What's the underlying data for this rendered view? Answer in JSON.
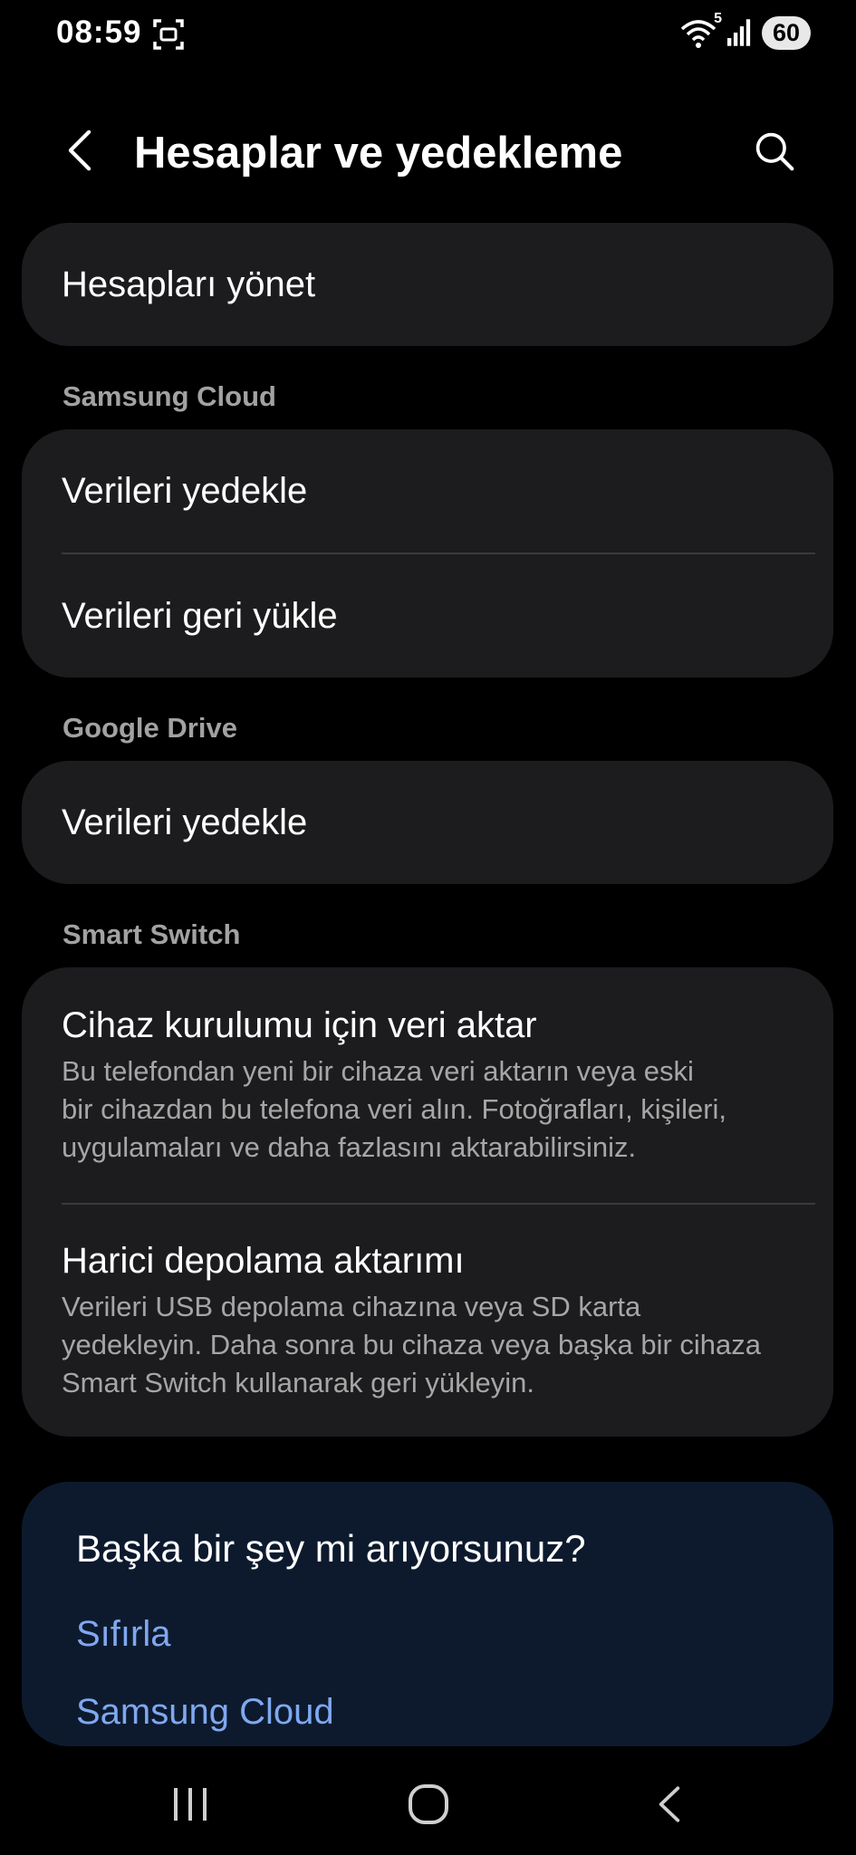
{
  "status_bar": {
    "time": "08:59",
    "wifi_badge": "5",
    "battery_level": "60",
    "icons": [
      "screen-record-icon",
      "wifi-icon",
      "signal-icon",
      "battery-icon"
    ]
  },
  "header": {
    "title": "Hesaplar ve yedekleme",
    "back_icon": "back-arrow-icon",
    "search_icon": "search-icon"
  },
  "manage_accounts": {
    "label": "Hesapları yönet"
  },
  "samsung_cloud": {
    "header": "Samsung Cloud",
    "items": [
      {
        "label": "Verileri yedekle"
      },
      {
        "label": "Verileri geri yükle"
      }
    ]
  },
  "google_drive": {
    "header": "Google Drive",
    "items": [
      {
        "label": "Verileri yedekle"
      }
    ]
  },
  "smart_switch": {
    "header": "Smart Switch",
    "items": [
      {
        "label": "Cihaz kurulumu için veri aktar",
        "desc_lines": [
          "Bu telefondan yeni bir cihaza veri aktarın veya eski",
          "bir cihazdan bu telefona veri alın. Fotoğrafları, kişileri,",
          "uygulamaları ve daha fazlasını aktarabilirsiniz."
        ]
      },
      {
        "label": "Harici depolama aktarımı",
        "desc_lines": [
          "Verileri USB depolama cihazına veya SD karta",
          "yedekleyin. Daha sonra bu cihaza veya başka bir cihaza",
          "Smart Switch kullanarak geri yükleyin."
        ]
      }
    ]
  },
  "suggestions": {
    "title": "Başka bir şey mi arıyorsunuz?",
    "links": [
      "Sıfırla",
      "Samsung Cloud"
    ]
  },
  "nav_bar": {
    "icons": [
      "recent-apps-icon",
      "home-icon",
      "back-icon"
    ]
  },
  "colors": {
    "background": "#000000",
    "card": "#1c1c1e",
    "suggest_card": "#0d1a2e",
    "link": "#7fa8f0",
    "secondary_text": "#a6a6a6"
  }
}
